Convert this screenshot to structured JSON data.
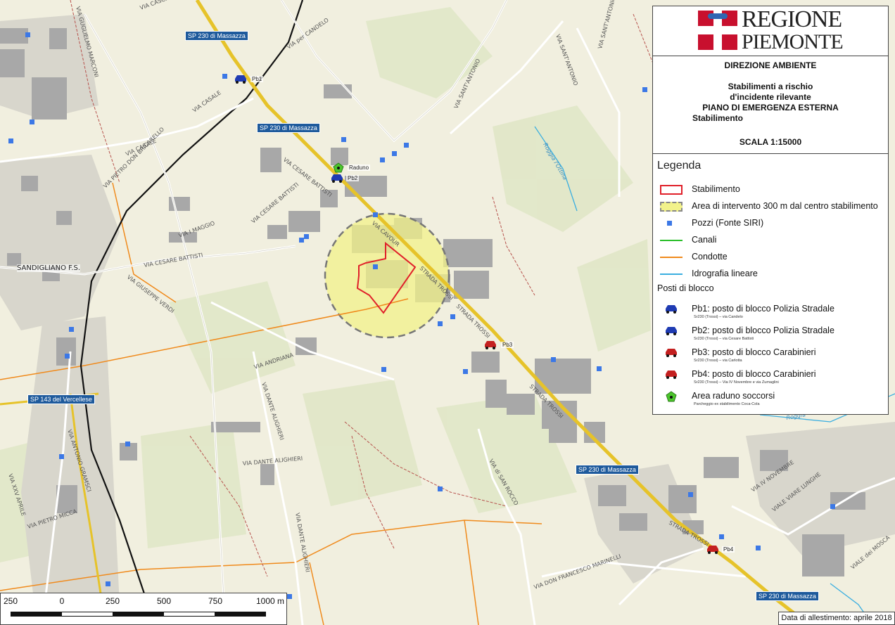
{
  "header": {
    "logo_line1": "REGIONE",
    "logo_line2": "PIEMONTE",
    "direzione": "DIREZIONE AMBIENTE",
    "title_line1": "Stabilimenti a rischio",
    "title_line2": "d'incidente rilevante",
    "title_line3": "PIANO DI EMERGENZA ESTERNA",
    "title_line4": "Stabilimento",
    "scale_text": "SCALA 1:15000"
  },
  "legend": {
    "title": "Legenda",
    "items": [
      {
        "label": "Stabilimento",
        "symbol": "stabilimento-outline",
        "color": "#e0202a"
      },
      {
        "label": "Area di intervento 300 m dal centro stabilimento",
        "symbol": "intervention-area",
        "color": "#f2f28a"
      },
      {
        "label": "Pozzi (Fonte SIRI)",
        "symbol": "well-square",
        "color": "#3c78e6"
      },
      {
        "label": "Canali",
        "symbol": "canal-line",
        "color": "#2bbf2b"
      },
      {
        "label": "Condotte",
        "symbol": "pipeline-line",
        "color": "#f08a1c"
      },
      {
        "label": "Idrografia lineare",
        "symbol": "hydro-line",
        "color": "#3aaee0"
      }
    ],
    "posti_title": "Posti di blocco",
    "posti": [
      {
        "label": "Pb1: posto di blocco Polizia Stradale",
        "sub": "Sr230 (Trossi) – via Candelo",
        "color": "#1f3bb3"
      },
      {
        "label": "Pb2: posto di blocco Polizia Stradale",
        "sub": "Sr230 (Trossi) – via Cesare Battisti",
        "color": "#1f3bb3"
      },
      {
        "label": "Pb3: posto di blocco Carabinieri",
        "sub": "Sr230 (Trossi) – via Carlotta",
        "color": "#c42020"
      },
      {
        "label": "Pb4: posto di blocco Carabinieri",
        "sub": "Sr230 (Trossi) – Via IV Novembre e via Zumaglini",
        "color": "#c42020"
      }
    ],
    "raduno": {
      "label": "Area raduno soccorsi",
      "sub": "Parcheggio ex stabilimento Coca-Cola",
      "color": "#4cc62c"
    }
  },
  "map": {
    "markers": {
      "pb1": "Pb1",
      "pb2": "Pb2",
      "pb3": "Pb3",
      "pb4": "Pb4",
      "raduno": "Raduno"
    },
    "shields": {
      "sp230_a": "SP 230 di Massazza",
      "sp230_b": "SP 230 di Massazza",
      "sp230_c": "SP 230 di Massazza",
      "sp230_d": "SP 230 di Massazza",
      "sp143": "SP 143 del Vercellese"
    },
    "places": {
      "sandigliano": "SANDIGLIANO F.S."
    },
    "streets": {
      "via_cavour": "VIA CAVOUR",
      "strada_trossi_1": "STRADA TROSSI",
      "strada_trossi_2": "STRADA TROSSI",
      "strada_trossi_3": "STRADA TROSSI",
      "strada_trossi_4": "STRADA TROSSI",
      "via_candelo": "VIA per CANDELO",
      "via_casale_1": "VIA CASALE",
      "via_casale_2": "VIA CASALE",
      "via_sant_antonio_1": "VIA SANT'ANTONIO",
      "via_sant_antonio_2": "VIA SANT'ANTONIO",
      "via_sant_antonio_3": "VIA SANT'ANTONIO",
      "via_cesare_battisti_1": "VIA CESARE BATTISTI",
      "via_cesare_battisti_2": "VIA CESARE BATTISTI",
      "via_cesare_battisti_3": "VIA CESARE BATTISTI",
      "via_maggio": "VIA I MAGGIO",
      "via_marconi": "VIA GUGLIELMO MARCONI",
      "via_don_bricarello": "VIA PIETRO DON BRICARELLO",
      "via_andriana": "VIA ANDRIANA",
      "via_dante_1": "VIA DANTE ALIGHIERI",
      "via_dante_2": "VIA DANTE ALIGHIERI",
      "via_dante_3": "VIA DANTE ALIGHIERI",
      "via_gramsci": "VIA ANTONIO GRAMSCI",
      "via_san_rocco": "VIA di SAN ROCCO",
      "via_viare_lunghe": "VIALE VIARE LUNGHE",
      "viale_mosca": "VIALE dei MOSCA",
      "via_iv_novembre": "VIA IV NOVEMBRE",
      "via_xxv_aprile": "VIA XXV APRILE",
      "via_verdi": "VIA GIUSEPPE VERDI",
      "via_marinelli": "VIA DON FRANCESCO MARINELLI",
      "via_pietro_micca": "VIA PIETRO MICCA",
      "via_cascinette": "VIA CASCINETTE",
      "roggia_1": "Roggia l'Ottina",
      "roggia_2": "Roggia"
    }
  },
  "scale_bar": {
    "ticks": [
      "250",
      "0",
      "250",
      "500",
      "750",
      "1000 m"
    ]
  },
  "footer": {
    "date": "Data di allestimento: aprile 2018"
  }
}
